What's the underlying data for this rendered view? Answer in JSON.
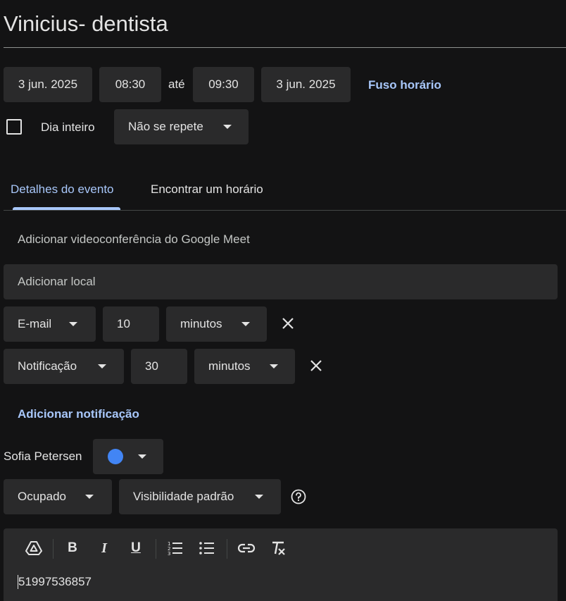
{
  "title": "Vinicius- dentista",
  "datetime": {
    "start_date": "3 jun. 2025",
    "start_time": "08:30",
    "until": "até",
    "end_time": "09:30",
    "end_date": "3 jun. 2025",
    "timezone_link": "Fuso horário"
  },
  "all_day": {
    "label": "Dia inteiro",
    "checked": false
  },
  "repeat": {
    "value": "Não se repete"
  },
  "tabs": [
    {
      "label": "Detalhes do evento",
      "active": true
    },
    {
      "label": "Encontrar um horário",
      "active": false
    }
  ],
  "meet": {
    "label": "Adicionar videoconferência do Google Meet"
  },
  "location": {
    "placeholder": "Adicionar local"
  },
  "notifications": [
    {
      "method": "E-mail",
      "amount": "10",
      "unit": "minutos"
    },
    {
      "method": "Notificação",
      "amount": "30",
      "unit": "minutos"
    }
  ],
  "add_notification": "Adicionar notificação",
  "calendar": {
    "owner": "Sofia Petersen",
    "color": "#4285f4"
  },
  "availability": {
    "value": "Ocupado"
  },
  "visibility": {
    "value": "Visibilidade padrão"
  },
  "description": {
    "text": "51997536857"
  },
  "toolbar_icons": [
    "drive-icon",
    "bold-icon",
    "italic-icon",
    "underline-icon",
    "numbered-list-icon",
    "bulleted-list-icon",
    "link-icon",
    "clear-formatting-icon"
  ]
}
